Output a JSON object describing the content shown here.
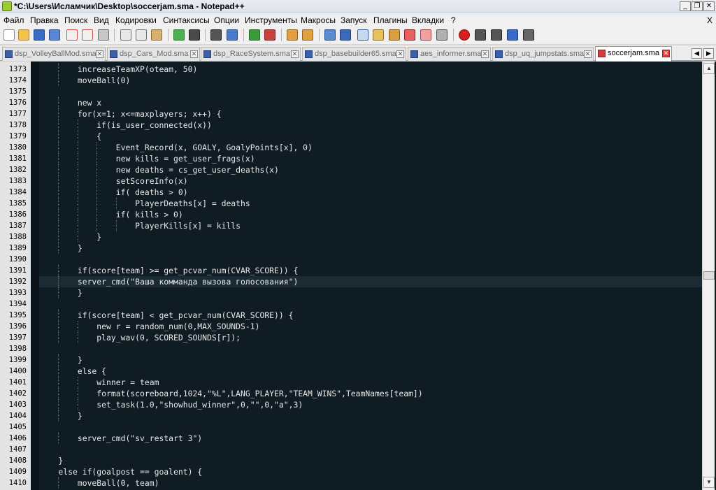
{
  "window": {
    "title": "*C:\\Users\\Исламчик\\Desktop\\soccerjam.sma - Notepad++",
    "minimize_label": "_",
    "maximize_label": "❐",
    "close_label": "✕"
  },
  "menu": {
    "items": [
      "Файл",
      "Правка",
      "Поиск",
      "Вид",
      "Кодировки",
      "Синтаксисы",
      "Опции",
      "Инструменты",
      "Макросы",
      "Запуск",
      "Плагины",
      "Вкладки",
      "?"
    ],
    "close_label": "X"
  },
  "tabs": [
    {
      "label": "dsp_VolleyBallMod.sma",
      "active": false
    },
    {
      "label": "dsp_Cars_Mod.sma",
      "active": false
    },
    {
      "label": "dsp_RaceSystem.sma",
      "active": false
    },
    {
      "label": "dsp_basebuilder65.sma",
      "active": false
    },
    {
      "label": "aes_informer.sma",
      "active": false
    },
    {
      "label": "dsp_uq_jumpstats.sma",
      "active": false
    },
    {
      "label": "soccerjam.sma",
      "active": true
    }
  ],
  "tab_close_label": "✕",
  "editor": {
    "current_line": 1392,
    "lines": [
      {
        "num": "1373",
        "text": "        increaseTeamXP(oteam, 50)"
      },
      {
        "num": "1374",
        "text": "        moveBall(0)"
      },
      {
        "num": "1375",
        "text": ""
      },
      {
        "num": "1376",
        "text": "        new x"
      },
      {
        "num": "1377",
        "text": "        for(x=1; x<=maxplayers; x++) {"
      },
      {
        "num": "1378",
        "text": "            if(is_user_connected(x))"
      },
      {
        "num": "1379",
        "text": "            {"
      },
      {
        "num": "1380",
        "text": "                Event_Record(x, GOALY, GoalyPoints[x], 0)"
      },
      {
        "num": "1381",
        "text": "                new kills = get_user_frags(x)"
      },
      {
        "num": "1382",
        "text": "                new deaths = cs_get_user_deaths(x)"
      },
      {
        "num": "1383",
        "text": "                setScoreInfo(x)"
      },
      {
        "num": "1384",
        "text": "                if( deaths > 0)"
      },
      {
        "num": "1385",
        "text": "                    PlayerDeaths[x] = deaths"
      },
      {
        "num": "1386",
        "text": "                if( kills > 0)"
      },
      {
        "num": "1387",
        "text": "                    PlayerKills[x] = kills"
      },
      {
        "num": "1388",
        "text": "            }"
      },
      {
        "num": "1389",
        "text": "        }"
      },
      {
        "num": "1390",
        "text": ""
      },
      {
        "num": "1391",
        "text": "        if(score[team] >= get_pcvar_num(CVAR_SCORE)) {"
      },
      {
        "num": "1392",
        "text": "        server_cmd(\"Ваша комманда вызова голосования\")"
      },
      {
        "num": "1393",
        "text": "        }"
      },
      {
        "num": "1394",
        "text": ""
      },
      {
        "num": "1395",
        "text": "        if(score[team] < get_pcvar_num(CVAR_SCORE)) {"
      },
      {
        "num": "1396",
        "text": "            new r = random_num(0,MAX_SOUNDS-1)"
      },
      {
        "num": "1397",
        "text": "            play_wav(0, SCORED_SOUNDS[r]);"
      },
      {
        "num": "1398",
        "text": ""
      },
      {
        "num": "1399",
        "text": "        }"
      },
      {
        "num": "1400",
        "text": "        else {"
      },
      {
        "num": "1401",
        "text": "            winner = team"
      },
      {
        "num": "1402",
        "text": "            format(scoreboard,1024,\"%L\",LANG_PLAYER,\"TEAM_WINS\",TeamNames[team])"
      },
      {
        "num": "1403",
        "text": "            set_task(1.0,\"showhud_winner\",0,\"\",0,\"a\",3)"
      },
      {
        "num": "1404",
        "text": "        }"
      },
      {
        "num": "1405",
        "text": ""
      },
      {
        "num": "1406",
        "text": "        server_cmd(\"sv_restart 3\")"
      },
      {
        "num": "1407",
        "text": ""
      },
      {
        "num": "1408",
        "text": "    }"
      },
      {
        "num": "1409",
        "text": "    else if(goalpost == goalent) {"
      },
      {
        "num": "1410",
        "text": "        moveBall(0, team)"
      }
    ]
  },
  "scrollbar": {
    "up_label": "▲",
    "down_label": "▼",
    "position": 0.5
  },
  "colors": {
    "editor_bg": "#0f1c23",
    "text": "#e8e8e8",
    "current_line_bg": "#1a2b33",
    "gutter_bg": "#e4e4e4",
    "active_tab_icon": "#d43b3b"
  }
}
